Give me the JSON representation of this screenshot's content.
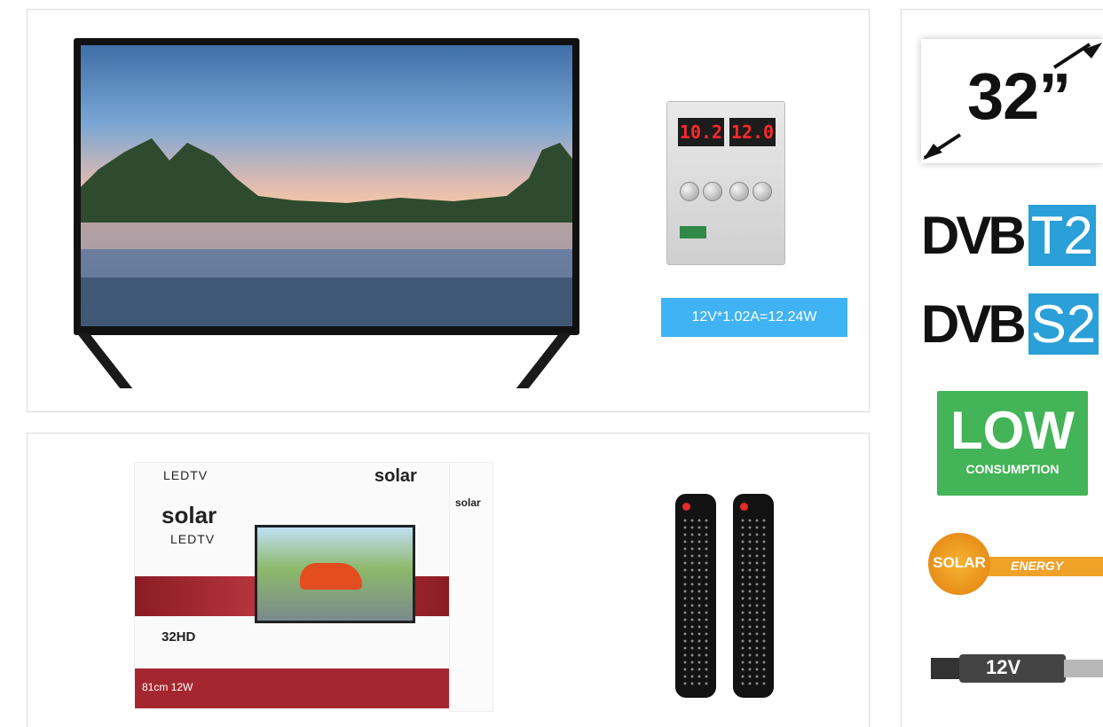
{
  "power_spec": "12V*1.02A=12.24W",
  "psu": {
    "voltage": "10.2",
    "current": "12.0"
  },
  "box": {
    "brand_top": "solar",
    "brand_main": "solar",
    "label_top": "LEDTV",
    "label_main": "LEDTV",
    "model": "32HD",
    "size_power": "81cm 12W",
    "side_brand": "solar"
  },
  "badges": {
    "screen_size": "32”",
    "dvb_t2_brand": "DVB",
    "dvb_t2_tag": "T2",
    "dvb_s2_brand": "DVB",
    "dvb_s2_tag": "S2",
    "low_line1": "LOW",
    "low_line2": "CONSUMPTION",
    "solar_word": "SOLAR",
    "energy_word": "ENERGY",
    "voltage_12v": "12V"
  },
  "colors": {
    "accent_blue": "#3fb3f3",
    "dvb_blue": "#2a9fd8",
    "low_green": "#43b457",
    "solar_orange": "#f0a128",
    "box_red": "#a42730"
  }
}
